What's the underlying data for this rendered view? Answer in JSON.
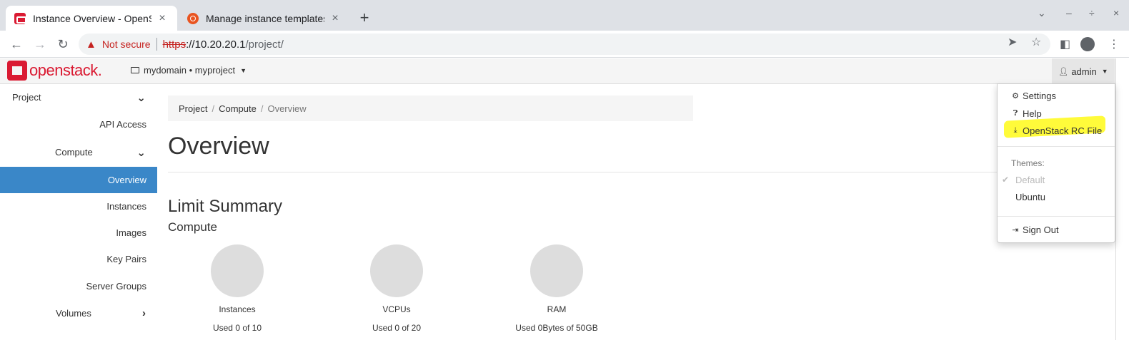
{
  "browser": {
    "tabs": [
      {
        "title": "Instance Overview - OpenStack Dashboard",
        "close": "×",
        "active": true
      },
      {
        "title": "Manage instance templates",
        "close": "×",
        "active": false
      }
    ],
    "new_tab": "+",
    "window_controls": {
      "dropdown": "⌄",
      "minimize": "–",
      "maximize": "÷",
      "close": "×"
    },
    "address": {
      "security_label": "Not secure",
      "scheme": "https",
      "host_prefix": "://10.20.20.1",
      "path": "/project/"
    }
  },
  "header": {
    "brand": "openstack.",
    "project_picker": "mydomain • myproject",
    "user_menu": "admin"
  },
  "sidebar": {
    "items": [
      {
        "label": "Project"
      },
      {
        "label": "API Access"
      },
      {
        "label": "Compute"
      },
      {
        "label": "Overview"
      },
      {
        "label": "Instances"
      },
      {
        "label": "Images"
      },
      {
        "label": "Key Pairs"
      },
      {
        "label": "Server Groups"
      },
      {
        "label": "Volumes"
      }
    ]
  },
  "breadcrumb": {
    "items": [
      "Project",
      "Compute",
      "Overview"
    ],
    "separator": "/"
  },
  "main": {
    "title": "Overview",
    "limit_summary": "Limit Summary",
    "compute_heading": "Compute",
    "limits": [
      {
        "label": "Instances",
        "usage": "Used 0 of 10"
      },
      {
        "label": "VCPUs",
        "usage": "Used 0 of 20"
      },
      {
        "label": "RAM",
        "usage": "Used 0Bytes of 50GB"
      }
    ]
  },
  "user_dropdown": {
    "settings": "Settings",
    "help": "Help",
    "rc_file": "OpenStack RC File",
    "themes_label": "Themes:",
    "theme_default": "Default",
    "theme_ubuntu": "Ubuntu",
    "sign_out": "Sign Out"
  },
  "colors": {
    "brand_red": "#da1a32",
    "sidebar_active": "#3a87c8",
    "highlight": "#fffb3a",
    "insecure_red": "#c5221f"
  }
}
